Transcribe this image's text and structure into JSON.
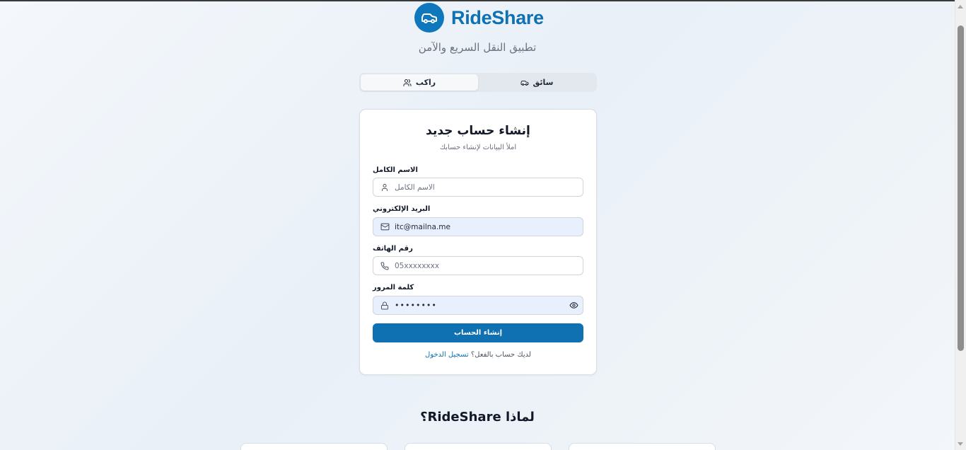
{
  "app": {
    "brand": "RideShare",
    "tagline": "تطبيق النقل السريع والآمن",
    "brand_color": "#0f70b2"
  },
  "role_toggle": {
    "driver_label": "سائق",
    "rider_label": "راكب",
    "selected": "راكب"
  },
  "form": {
    "title": "إنشاء حساب جديد",
    "subtitle": "املأ البيانات لإنشاء حسابك",
    "full_name": {
      "label": "الاسم الكامل",
      "placeholder": "الاسم الكامل",
      "value": ""
    },
    "email": {
      "label": "البريد الإلكتروني",
      "value": "itc@mailna.me"
    },
    "phone": {
      "label": "رقم الهاتف",
      "placeholder": "05xxxxxxxx",
      "value": ""
    },
    "password": {
      "label": "كلمة المرور",
      "value": "••••••••"
    },
    "submit_label": "إنشاء الحساب",
    "have_account_text": "لديك حساب بالفعل؟",
    "login_link": "تسجيل الدخول"
  },
  "why_section": {
    "prefix": "لماذا",
    "brand": "RideShare",
    "suffix": "؟"
  },
  "icons": {
    "logo": "car-icon",
    "driver": "car-icon",
    "rider": "users-icon",
    "name_field": "user-icon",
    "email_field": "mail-icon",
    "phone_field": "phone-icon",
    "password_field": "lock-icon",
    "toggle_password": "eye-icon"
  }
}
